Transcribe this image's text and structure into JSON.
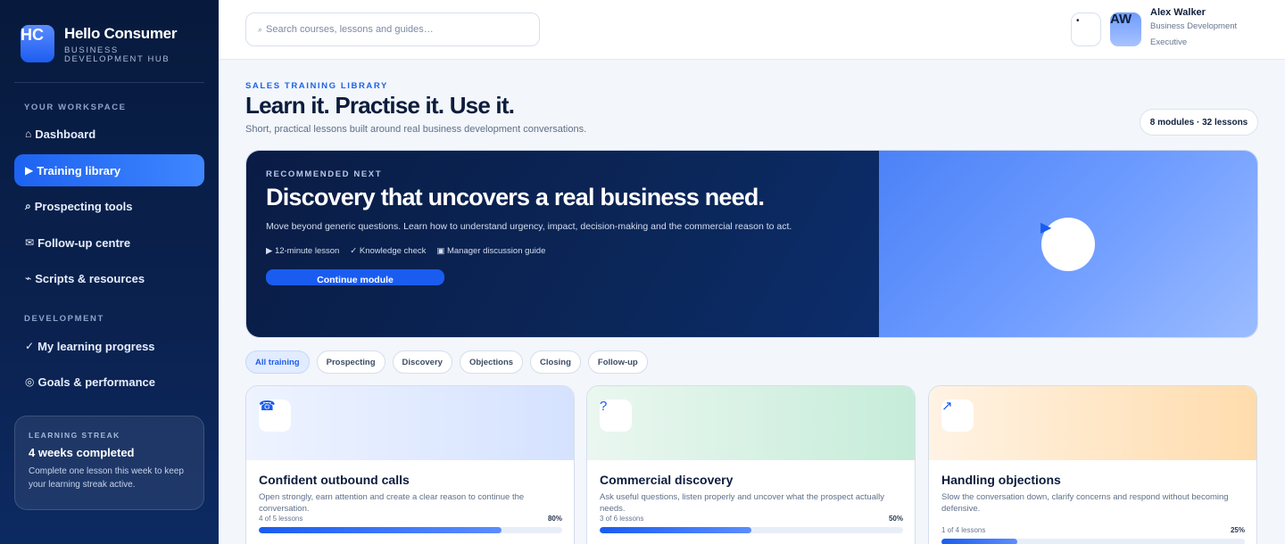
{
  "brand": {
    "logo": "HC",
    "title": "Hello Consumer",
    "subtitle": "BUSINESS DEVELOPMENT HUB"
  },
  "sidebar": {
    "sections": [
      {
        "heading": "YOUR WORKSPACE"
      },
      {
        "heading": "DEVELOPMENT"
      }
    ],
    "items": [
      {
        "icon": "⌂",
        "label": "Dashboard",
        "icon_name": "home-icon"
      },
      {
        "icon": "▶",
        "label": "Training library",
        "icon_name": "play-icon",
        "active": true
      },
      {
        "icon": "⌕",
        "label": "Prospecting tools",
        "icon_name": "search-icon"
      },
      {
        "icon": "✉",
        "label": "Follow-up centre",
        "icon_name": "mail-icon"
      },
      {
        "icon": "⌁",
        "label": "Scripts & resources",
        "icon_name": "link-icon"
      },
      {
        "icon": "✓",
        "label": "My learning progress",
        "icon_name": "check-icon"
      },
      {
        "icon": "◎",
        "label": "Goals & performance",
        "icon_name": "target-icon"
      }
    ],
    "streak": {
      "kicker": "LEARNING STREAK",
      "title": "4 weeks completed",
      "desc": "Complete one lesson this week to keep your learning streak active."
    }
  },
  "topbar": {
    "search_icon": "⌕",
    "search_placeholder": "Search courses, lessons and guides…",
    "notification_icon": "•",
    "avatar_initials": "AW",
    "user_name": "Alex Walker",
    "user_role": "Business Development Executive"
  },
  "header": {
    "eyebrow": "SALES TRAINING LIBRARY",
    "title": "Learn it. Practise it. Use it.",
    "subtitle": "Short, practical lessons built around real business development conversations.",
    "count_badge": "8 modules · 32 lessons"
  },
  "hero": {
    "kicker": "RECOMMENDED NEXT",
    "title": "Discovery that uncovers a real business need.",
    "desc": "Move beyond generic questions. Learn how to understand urgency, impact, decision-making and the commercial reason to act.",
    "features": [
      "▶ 12-minute lesson",
      "✓ Knowledge check",
      "▣ Manager discussion guide"
    ],
    "button": "Continue module",
    "play_icon": "▶"
  },
  "filters": [
    "All training",
    "Prospecting",
    "Discovery",
    "Objections",
    "Closing",
    "Follow-up"
  ],
  "colors": {
    "accent": "#1a5cf0",
    "sidebar": "#0b2250"
  },
  "cards": [
    {
      "icon": "☎",
      "icon_name": "phone-icon",
      "title": "Confident outbound calls",
      "desc": "Open strongly, earn attention and create a clear reason to continue the conversation.",
      "lessons": "4 of 5 lessons",
      "pct": "80%",
      "progress": 0.8
    },
    {
      "icon": "?",
      "icon_name": "question-icon",
      "title": "Commercial discovery",
      "desc": "Ask useful questions, listen properly and uncover what the prospect actually needs.",
      "lessons": "3 of 6 lessons",
      "pct": "50%",
      "progress": 0.5
    },
    {
      "icon": "↗",
      "icon_name": "trend-up-icon",
      "title": "Handling objections",
      "desc": "Slow the conversation down, clarify concerns and respond without becoming defensive.",
      "lessons": "1 of 4 lessons",
      "pct": "25%",
      "progress": 0.25
    }
  ]
}
